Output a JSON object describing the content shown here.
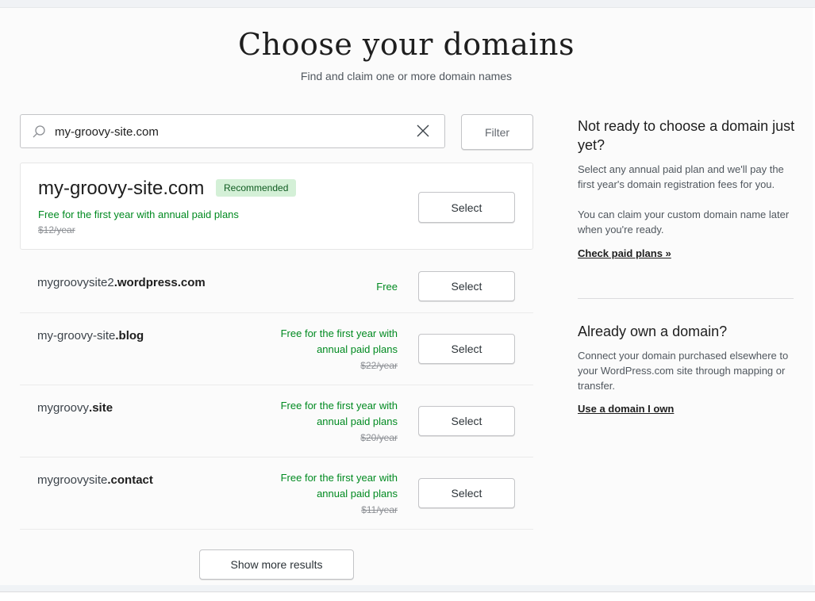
{
  "header": {
    "title": "Choose your domains",
    "subtitle": "Find and claim one or more domain names"
  },
  "search": {
    "value": "my-groovy-site.com",
    "filter_label": "Filter"
  },
  "recommended": {
    "domain": "my-groovy-site.com",
    "badge": "Recommended",
    "price_note": "Free for the first year with annual paid plans",
    "original_price": "$12/year",
    "select_label": "Select"
  },
  "results": [
    {
      "prefix": "mygroovysite2",
      "suffix": ".wordpress.com",
      "price_note_1": "Free",
      "price_note_2": "",
      "original_price": "",
      "select_label": "Select"
    },
    {
      "prefix": "my-groovy-site",
      "suffix": ".blog",
      "price_note_1": "Free for the first year with",
      "price_note_2": "annual paid plans",
      "original_price": "$22/year",
      "select_label": "Select"
    },
    {
      "prefix": "mygroovy",
      "suffix": ".site",
      "price_note_1": "Free for the first year with",
      "price_note_2": "annual paid plans",
      "original_price": "$20/year",
      "select_label": "Select"
    },
    {
      "prefix": "mygroovysite",
      "suffix": ".contact",
      "price_note_1": "Free for the first year with",
      "price_note_2": "annual paid plans",
      "original_price": "$11/year",
      "select_label": "Select"
    }
  ],
  "show_more_label": "Show more results",
  "sidebar": {
    "not_ready": {
      "heading": "Not ready to choose a domain just yet?",
      "text1": "Select any annual paid plan and we'll pay the first year's domain registration fees for you.",
      "text2": "You can claim your custom domain name later when you're ready.",
      "link": "Check paid plans »"
    },
    "own_domain": {
      "heading": "Already own a domain?",
      "text": "Connect your domain purchased elsewhere to your WordPress.com site through mapping or transfer.",
      "link": "Use a domain I own"
    }
  },
  "colors": {
    "accent_green": "#008a20",
    "badge_bg": "#d4f0d7"
  }
}
